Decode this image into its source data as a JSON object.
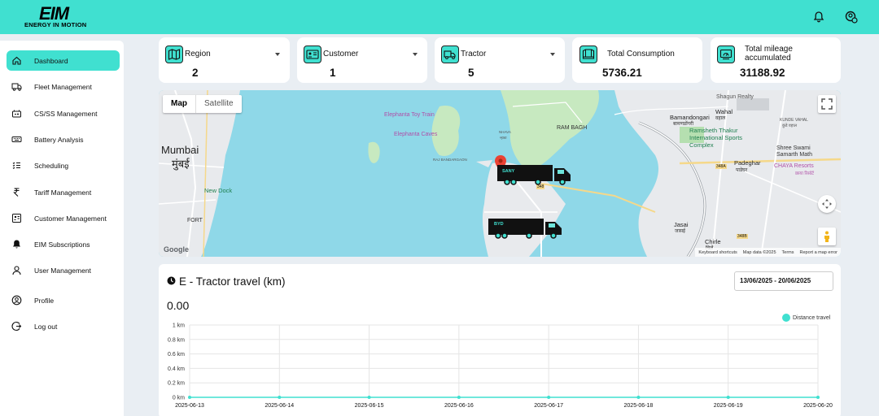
{
  "brand": {
    "logo_main": "EIM",
    "logo_sub": "ENERGY IN MOTION"
  },
  "sidebar": {
    "items": [
      {
        "label": "Dashboard",
        "icon": "home-icon",
        "active": true
      },
      {
        "label": "Fleet Management",
        "icon": "truck-icon"
      },
      {
        "label": "CS/SS Management",
        "icon": "battery-station-icon"
      },
      {
        "label": "Battery Analysis",
        "icon": "keyboard-icon"
      },
      {
        "label": "Scheduling",
        "icon": "list-icon"
      },
      {
        "label": "Tariff Management",
        "icon": "rupee-icon"
      },
      {
        "label": "Customer Management",
        "icon": "id-card-icon"
      },
      {
        "label": "EIM Subscriptions",
        "icon": "bell-icon"
      },
      {
        "label": "User Management",
        "icon": "user-icon"
      },
      {
        "label": "Profile",
        "icon": "profile-circle-icon"
      },
      {
        "label": "Log out",
        "icon": "logout-icon"
      }
    ]
  },
  "cards": [
    {
      "title": "Region",
      "value": "2",
      "icon": "map-icon",
      "dropdown": true
    },
    {
      "title": "Customer",
      "value": "1",
      "icon": "id-card-icon",
      "dropdown": true
    },
    {
      "title": "Tractor",
      "value": "5",
      "icon": "truck-icon",
      "dropdown": true
    },
    {
      "title": "Total Consumption",
      "value": "5736.21",
      "icon": "book-icon",
      "dropdown": false
    },
    {
      "title_line1": "Total mileage",
      "title_line2": "accumulated",
      "value": "31188.92",
      "icon": "gauge-icon",
      "dropdown": false
    }
  ],
  "map": {
    "type_map": "Map",
    "type_satellite": "Satellite",
    "labels": {
      "mumbai_en": "Mumbai",
      "mumbai_mr": "मुंबई",
      "new_dock": "New Dock",
      "fort": "FORT",
      "elephanta_toy_train": "Elephanta Toy Train",
      "elephanta_caves": "Elephanta Caves",
      "raj_bandargaon": "RAJ BANDARGAON",
      "nhava": "NHAVA",
      "nhava_mr": "न्हावा",
      "ram_bagh": "RAM BAGH",
      "shagun_realty": "Shagun Realty",
      "wahal": "Wahal",
      "wahal_mr": "वहाल",
      "bamandongari": "Bamandongari",
      "bamandongari_mr": "बामणडोंगरी",
      "ramsheth": "Ramsheth Thakur",
      "ramsheth2": "International Sports",
      "ramsheth3": "Complex",
      "kunde_vahal": "KUNDE VAHAL",
      "kunde_vahal_mr": "कुंडे वहाल",
      "shree_swami": "Shree Swami",
      "samarth_math": "Samarth Math",
      "padeghar": "Padeghar",
      "padeghar_mr": "पाडेघर",
      "chaya": "CHAYA Resorts",
      "chaya_mr": "छाया रिसॉर्ट",
      "jasai": "Jasai",
      "jasai_mr": "जासई",
      "chirle": "Chirle",
      "chirle_mr": "चिर्ले",
      "road_348": "348",
      "road_348a": "348A",
      "road_348b": "348B",
      "google": "Google"
    },
    "trucks": [
      {
        "label": "SANY"
      },
      {
        "label": "BYD"
      }
    ],
    "footer": {
      "shortcuts": "Keyboard shortcuts",
      "mapdata": "Map data ©2025",
      "terms": "Terms",
      "report": "Report a map error"
    }
  },
  "travel_chart": {
    "title": "E - Tractor travel (km)",
    "date_range": "13/06/2025 - 20/06/2025",
    "total": "0.00"
  },
  "chart_data": {
    "type": "line",
    "title": "E - Tractor travel (km)",
    "x": [
      "2025-06-13",
      "2025-06-14",
      "2025-06-15",
      "2025-06-16",
      "2025-06-17",
      "2025-06-18",
      "2025-06-19",
      "2025-06-20"
    ],
    "series": [
      {
        "name": "Distance travel",
        "values": [
          0,
          0,
          0,
          0,
          0,
          0,
          0,
          0
        ],
        "color": "#40e0d0"
      }
    ],
    "ylim": [
      0,
      1
    ],
    "yticks": [
      "0 km",
      "0.2 km",
      "0.4 km",
      "0.6 km",
      "0.8 km",
      "1 km"
    ],
    "ytick_values": [
      0,
      0.2,
      0.4,
      0.6,
      0.8,
      1
    ],
    "grid": true,
    "legend": "top-right"
  }
}
